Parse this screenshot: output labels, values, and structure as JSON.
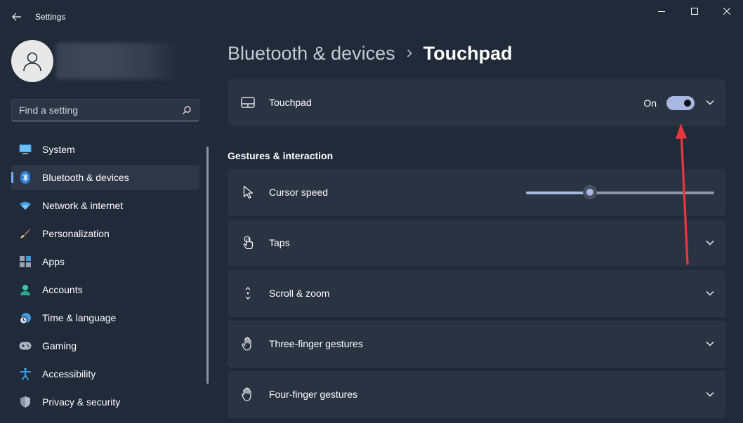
{
  "window": {
    "title": "Settings"
  },
  "search": {
    "placeholder": "Find a setting"
  },
  "nav": {
    "items": [
      {
        "label": "System",
        "icon": "monitor-icon",
        "selected": false
      },
      {
        "label": "Bluetooth & devices",
        "icon": "bluetooth-icon",
        "selected": true
      },
      {
        "label": "Network & internet",
        "icon": "wifi-icon",
        "selected": false
      },
      {
        "label": "Personalization",
        "icon": "brush-icon",
        "selected": false
      },
      {
        "label": "Apps",
        "icon": "apps-icon",
        "selected": false
      },
      {
        "label": "Accounts",
        "icon": "person-icon",
        "selected": false
      },
      {
        "label": "Time & language",
        "icon": "globe-clock-icon",
        "selected": false
      },
      {
        "label": "Gaming",
        "icon": "gamepad-icon",
        "selected": false
      },
      {
        "label": "Accessibility",
        "icon": "accessibility-icon",
        "selected": false
      },
      {
        "label": "Privacy & security",
        "icon": "shield-icon",
        "selected": false
      }
    ]
  },
  "breadcrumb": {
    "parent": "Bluetooth & devices",
    "current": "Touchpad"
  },
  "touchpad": {
    "label": "Touchpad",
    "state_label": "On",
    "enabled": true
  },
  "section": {
    "title": "Gestures & interaction"
  },
  "cursor_speed": {
    "label": "Cursor speed",
    "value_fraction": 0.34
  },
  "cards": [
    {
      "label": "Taps",
      "icon": "tap-icon"
    },
    {
      "label": "Scroll & zoom",
      "icon": "scroll-icon"
    },
    {
      "label": "Three-finger gestures",
      "icon": "hand-icon"
    },
    {
      "label": "Four-finger gestures",
      "icon": "hand-icon"
    }
  ],
  "colors": {
    "accent": "#a8b8e0",
    "selection_indicator": "#6fb4ff",
    "annotation_arrow": "#e8383d"
  }
}
